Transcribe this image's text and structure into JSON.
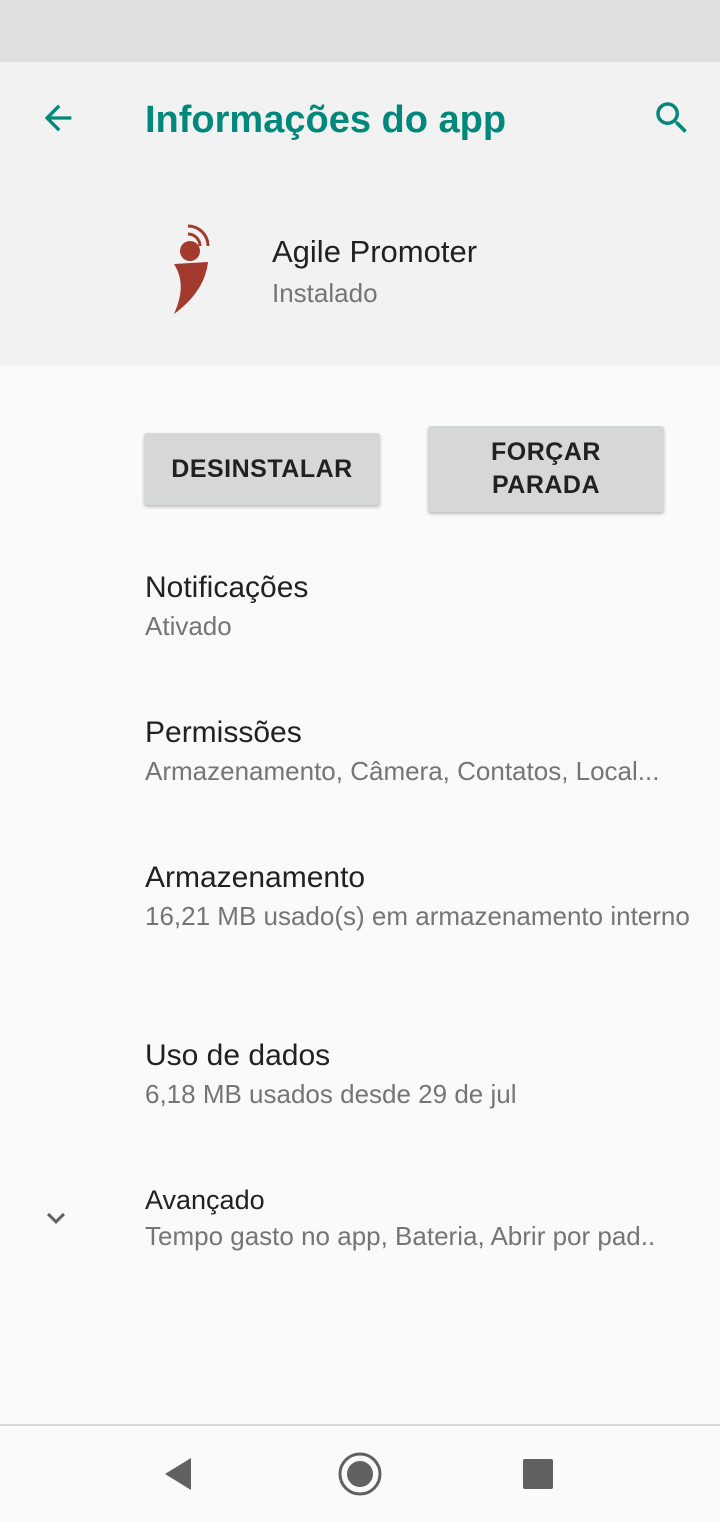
{
  "header": {
    "title": "Informações do app",
    "back_icon": "arrow-back-icon",
    "search_icon": "search-icon",
    "accent_color": "#00897b"
  },
  "app": {
    "name": "Agile Promoter",
    "status": "Instalado",
    "icon": "agile-promoter-logo-icon",
    "icon_color": "#a33a2e"
  },
  "actions": {
    "uninstall_label": "DESINSTALAR",
    "force_stop_label": "FORÇAR PARADA"
  },
  "preferences": [
    {
      "title": "Notificações",
      "summary": "Ativado"
    },
    {
      "title": "Permissões",
      "summary": "Armazenamento, Câmera, Contatos, Local..."
    },
    {
      "title": "Armazenamento",
      "summary": "16,21 MB usado(s) em armazenamento interno"
    },
    {
      "title": "Uso de dados",
      "summary": "6,18 MB usados desde 29 de jul"
    }
  ],
  "advanced": {
    "title": "Avançado",
    "summary": "Tempo gasto no app, Bateria, Abrir por pad..",
    "icon": "chevron-down-icon"
  },
  "navigation": {
    "back_icon": "nav-back-icon",
    "home_icon": "nav-home-icon",
    "recents_icon": "nav-recents-icon"
  }
}
